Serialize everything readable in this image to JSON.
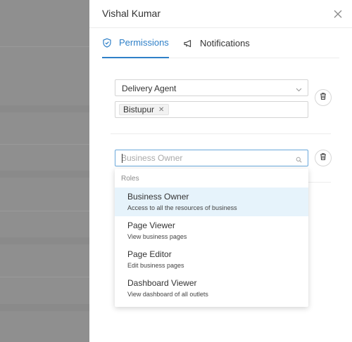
{
  "drawer": {
    "title": "Vishal Kumar"
  },
  "tabs": [
    {
      "label": "Permissions",
      "active": true,
      "icon": "shield-icon"
    },
    {
      "label": "Notifications",
      "active": false,
      "icon": "megaphone-icon"
    }
  ],
  "role_block_1": {
    "role_value": "Delivery Agent",
    "locations": [
      "Bistupur"
    ]
  },
  "role_block_2": {
    "search_placeholder": "Business Owner"
  },
  "dropdown": {
    "group_label": "Roles",
    "options": [
      {
        "title": "Business Owner",
        "description": "Access to all the resources of business",
        "highlighted": true
      },
      {
        "title": "Page Viewer",
        "description": "View business pages",
        "highlighted": false
      },
      {
        "title": "Page Editor",
        "description": "Edit business pages",
        "highlighted": false
      },
      {
        "title": "Dashboard Viewer",
        "description": "View dashboard of all outlets",
        "highlighted": false
      }
    ]
  },
  "colors": {
    "accent": "#2f80c8",
    "highlight_bg": "#e6f3fb",
    "overlay": "#8f8f8f"
  }
}
